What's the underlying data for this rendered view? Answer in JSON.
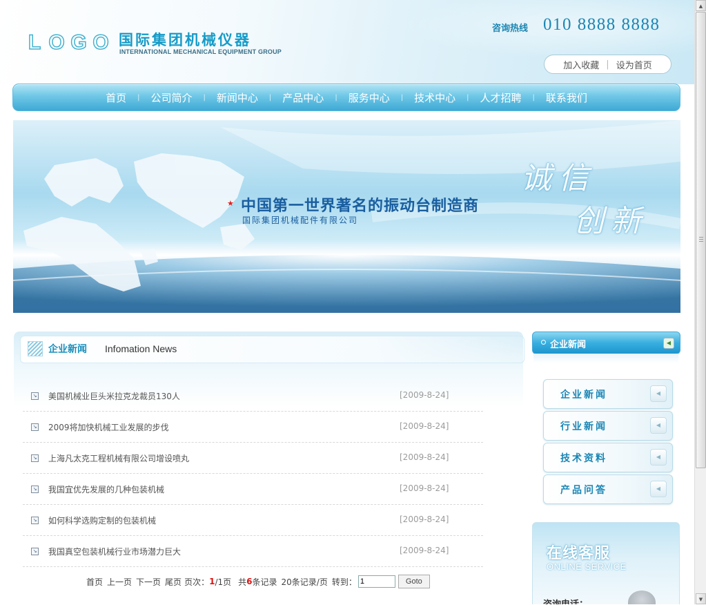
{
  "header": {
    "logo_text": "LOGO",
    "company_cn": "国际集团机械仪器",
    "company_en": "INTERNATIONAL MECHANICAL EQUIPMENT GROUP",
    "hotline_label": "咨询热线",
    "hotline_number": "010 8888 8888",
    "favorite_label": "加入收藏",
    "homepage_label": "设为首页"
  },
  "nav": {
    "items": [
      "首页",
      "公司简介",
      "新闻中心",
      "产品中心",
      "服务中心",
      "技术中心",
      "人才招聘",
      "联系我们"
    ]
  },
  "banner": {
    "title": "中国第一世界著名的振动台制造商",
    "subtitle": "国际集团机械配件有限公司",
    "slogan_line1": "诚信",
    "slogan_line2": "创新"
  },
  "main": {
    "section_title": "企业新闻",
    "section_subtitle": "Infomation News",
    "news": [
      {
        "title": "美国机械业巨头米拉克龙裁员130人",
        "date": "[2009-8-24]"
      },
      {
        "title": "2009将加快机械工业发展的步伐",
        "date": "[2009-8-24]"
      },
      {
        "title": "上海凡太克工程机械有限公司增设喷丸",
        "date": "[2009-8-24]"
      },
      {
        "title": "我国宜优先发展的几种包装机械",
        "date": "[2009-8-24]"
      },
      {
        "title": "如何科学选购定制的包装机械",
        "date": "[2009-8-24]"
      },
      {
        "title": "我国真空包装机械行业市场潜力巨大",
        "date": "[2009-8-24]"
      }
    ],
    "pager": {
      "first": "首页",
      "prev": "上一页",
      "next": "下一页",
      "last": "尾页",
      "page_label": "页次：",
      "current_page": "1",
      "page_total": "/1页",
      "total_prefix": "共",
      "total_count": "6",
      "total_suffix": "条记录",
      "per_page": "20条记录/页",
      "goto_label": "转到：",
      "goto_value": "1",
      "goto_button": "Goto"
    }
  },
  "sidebar": {
    "title": "企业新闻",
    "categories": [
      "企业新闻",
      "行业新闻",
      "技术资料",
      "产品问答"
    ],
    "online": {
      "title": "在线客服",
      "subtitle": "ONLINE SERVICE",
      "phone_label": "咨询电话："
    }
  },
  "colors": {
    "accent": "#1b8fbc",
    "nav_bg": "#3ea9d5",
    "date": "#9b9b9b",
    "highlight": "#dd1111"
  }
}
